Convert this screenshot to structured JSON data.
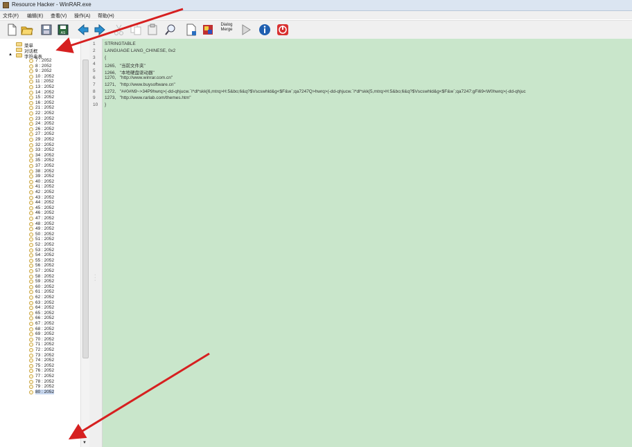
{
  "window": {
    "title": "Resource Hacker - WinRAR.exe"
  },
  "menu": [
    "文件(F)",
    "编辑(E)",
    "查看(V)",
    "操作(A)",
    "帮助(H)"
  ],
  "toolbar": {
    "buttons": [
      {
        "name": "new-icon"
      },
      {
        "name": "open-icon"
      },
      {
        "name": "save-icon"
      },
      {
        "name": "save-as-icon"
      },
      {
        "name": "back-icon"
      },
      {
        "name": "forward-icon"
      },
      {
        "name": "cut-icon"
      },
      {
        "name": "copy-icon"
      },
      {
        "name": "paste-icon"
      },
      {
        "name": "find-icon"
      },
      {
        "name": "add-resource-icon"
      },
      {
        "name": "resource-bitmap-icon"
      },
      {
        "name": "dialog-merge-icon",
        "label": "Dialog Merge"
      },
      {
        "name": "play-icon"
      },
      {
        "name": "info-icon"
      },
      {
        "name": "stop-icon"
      }
    ]
  },
  "tree": {
    "roots": [
      "菜单",
      "对话框",
      "字符串表"
    ],
    "items": [
      "7 : 2052",
      "8 : 2052",
      "9 : 2052",
      "10 : 2052",
      "11 : 2052",
      "13 : 2052",
      "14 : 2052",
      "15 : 2052",
      "16 : 2052",
      "21 : 2052",
      "22 : 2052",
      "23 : 2052",
      "24 : 2052",
      "26 : 2052",
      "27 : 2052",
      "29 : 2052",
      "32 : 2052",
      "33 : 2052",
      "34 : 2052",
      "35 : 2052",
      "37 : 2052",
      "38 : 2052",
      "39 : 2052",
      "40 : 2052",
      "41 : 2052",
      "42 : 2052",
      "43 : 2052",
      "44 : 2052",
      "45 : 2052",
      "46 : 2052",
      "47 : 2052",
      "48 : 2052",
      "49 : 2052",
      "50 : 2052",
      "51 : 2052",
      "52 : 2052",
      "53 : 2052",
      "54 : 2052",
      "55 : 2052",
      "56 : 2052",
      "57 : 2052",
      "58 : 2052",
      "59 : 2052",
      "60 : 2052",
      "61 : 2052",
      "62 : 2052",
      "63 : 2052",
      "64 : 2052",
      "65 : 2052",
      "66 : 2052",
      "67 : 2052",
      "68 : 2052",
      "69 : 2052",
      "70 : 2052",
      "71 : 2052",
      "72 : 2052",
      "73 : 2052",
      "74 : 2052",
      "75 : 2052",
      "76 : 2052",
      "77 : 2052",
      "78 : 2052",
      "79 : 2052",
      "80 : 2052"
    ]
  },
  "editor": {
    "lines": [
      {
        "n": "1",
        "text": "STRINGTABLE"
      },
      {
        "n": "2",
        "text": "LANGUAGE LANG_CHINESE, 0x2"
      },
      {
        "n": "3",
        "text": "{"
      },
      {
        "n": "4",
        "text": "1265,   \"当前文件夹\""
      },
      {
        "n": "5",
        "text": "1266,   \"本地硬盘驱动器\""
      },
      {
        "n": "6",
        "text": "1270,   \"http://www.winrar.com.cn\""
      },
      {
        "n": "7",
        "text": "1271,   \"http://www.buysoftware.cn\""
      },
      {
        "n": "8",
        "text": "1272,   \"##0#N9~>34P9hwrq>(-dd-qhjucw.`I*dl*skk{6,mtrq>H:5&bo;6&q?$Vscswhld&g<$F&w`;qa7247Q>hwrq>(-dd-qhjucw.`I*dl*skk{5,mtrq>H:5&bo;6&q?$Vscswhld&g<$F&w`;qa7247:gFi69<W0hwrq>(-dd-qhjuc"
      },
      {
        "n": "9",
        "text": "1273,   \"http://www.rarlab.com/themes.htm\""
      },
      {
        "n": "10",
        "text": "}"
      }
    ]
  },
  "colors": {
    "editor_bg": "#c9e6cb",
    "annotation_arrow": "#d62020"
  }
}
